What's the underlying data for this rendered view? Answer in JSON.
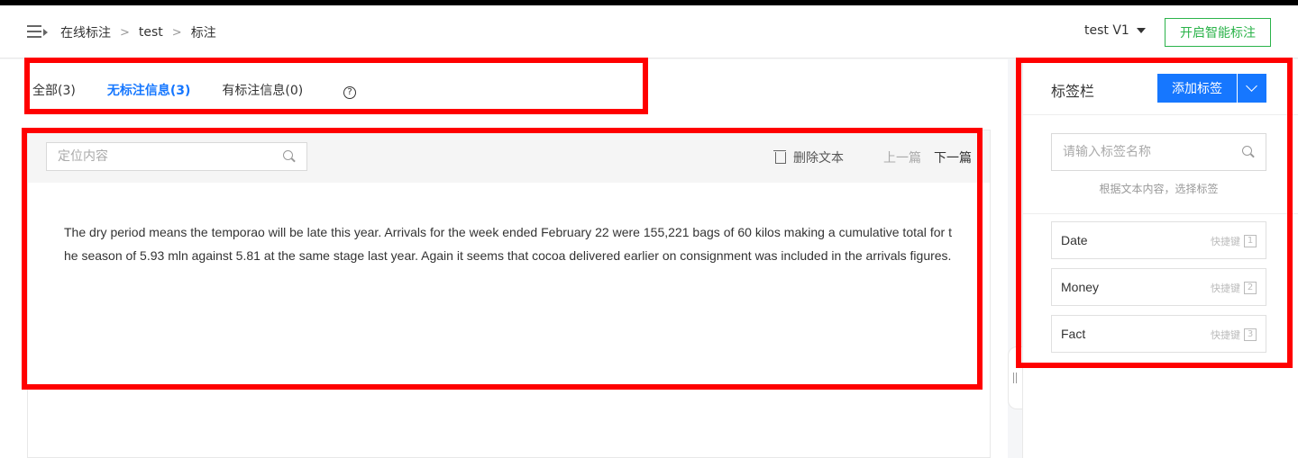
{
  "header": {
    "breadcrumbs": [
      "在线标注",
      "test",
      "标注"
    ],
    "version_label": "test V1",
    "smart_label_button": "开启智能标注"
  },
  "tabs": [
    {
      "label": "全部(3)",
      "active": false
    },
    {
      "label": "无标注信息(3)",
      "active": true
    },
    {
      "label": "有标注信息(0)",
      "active": false
    }
  ],
  "help_icon_glyph": "?",
  "toolbar": {
    "search_placeholder": "定位内容",
    "delete_label": "删除文本",
    "prev_label": "上一篇",
    "next_label": "下一篇"
  },
  "document_text": "The dry period means the temporao will be late this year. Arrivals for the week ended February 22 were 155,221 bags of 60 kilos making a cumulative total for the season of 5.93 mln against 5.81 at the same stage last year. Again it seems that cocoa delivered earlier on consignment was included in the arrivals figures.",
  "side_panel": {
    "title": "标签栏",
    "add_button": "添加标签",
    "search_placeholder": "请输入标签名称",
    "hint": "根据文本内容，选择标签",
    "shortcut_label": "快捷键",
    "tags": [
      {
        "name": "Date",
        "key": "1"
      },
      {
        "name": "Money",
        "key": "2"
      },
      {
        "name": "Fact",
        "key": "3"
      }
    ]
  },
  "colors": {
    "accent_blue": "#1677ff",
    "accent_green": "#2bb34a",
    "highlight_red": "#ff0000"
  }
}
